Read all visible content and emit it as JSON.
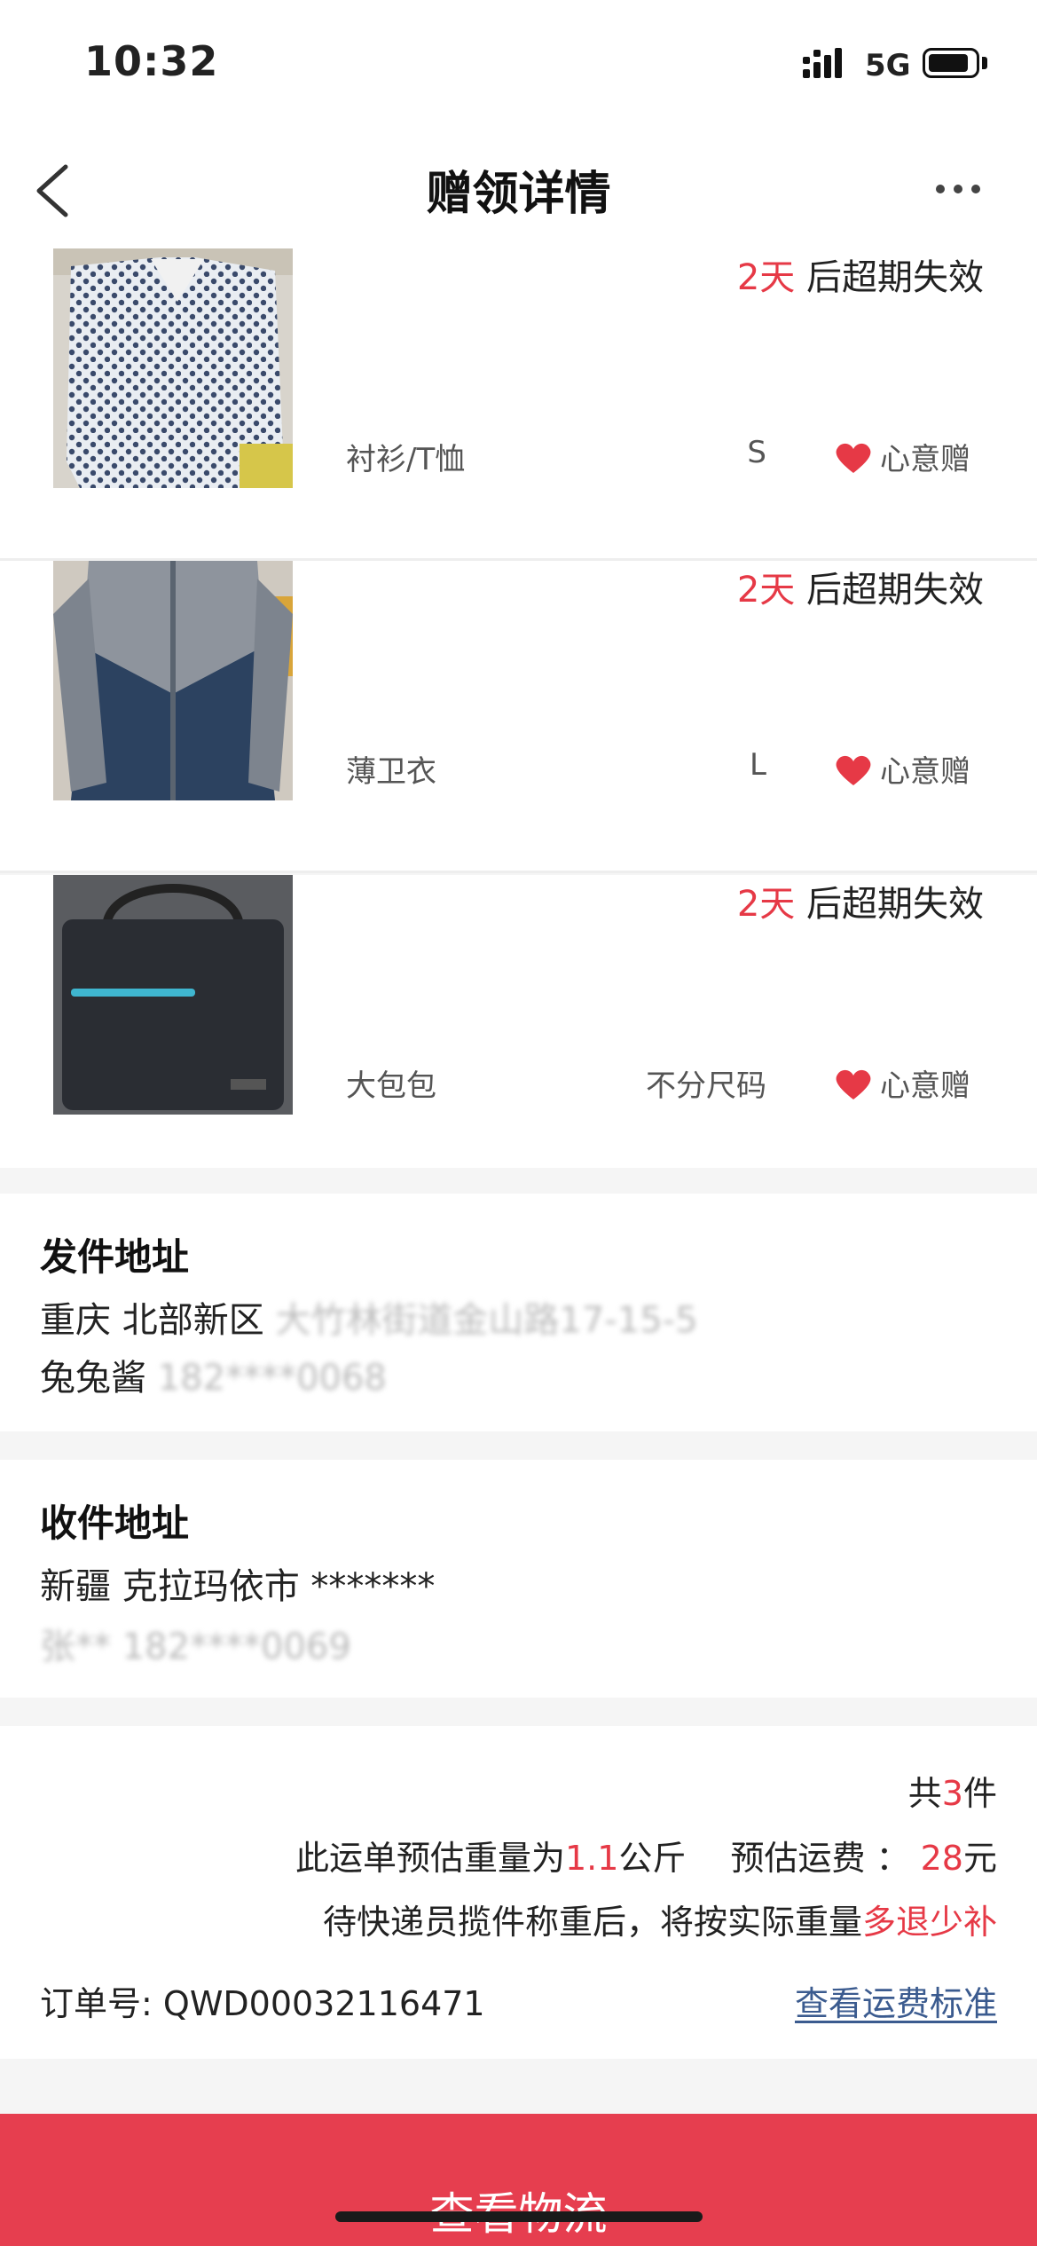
{
  "status_bar": {
    "time": "10:32",
    "network": "5G"
  },
  "nav": {
    "title": "赠领详情"
  },
  "items": [
    {
      "expire_days": "2天",
      "expire_suffix": " 后超期失效",
      "category": "衬衫/T恤",
      "size": "S",
      "gift_label": "心意赠",
      "image": "shirt-photo"
    },
    {
      "expire_days": "2天",
      "expire_suffix": " 后超期失效",
      "category": "薄卫衣",
      "size": "L",
      "gift_label": "心意赠",
      "image": "jacket-photo"
    },
    {
      "expire_days": "2天",
      "expire_suffix": " 后超期失效",
      "category": "大包包",
      "size": "不分尺码",
      "gift_label": "心意赠",
      "image": "bag-photo"
    }
  ],
  "sender": {
    "title": "发件地址",
    "address_visible": "重庆 北部新区",
    "address_blurred": "大竹林街道金山路17-15-5",
    "name_visible": "兔兔酱",
    "phone_blurred": "182****0068"
  },
  "receiver": {
    "title": "收件地址",
    "address": "新疆 克拉玛依市 *******",
    "contact_blurred": "张**  182****0069"
  },
  "summary": {
    "count_prefix": "共",
    "count": "3",
    "count_suffix": "件",
    "weight_prefix": "此运单预估重量为",
    "weight_value": "1.1",
    "weight_unit": "公斤",
    "fee_prefix": "预估运费 ：",
    "fee_value": "28",
    "fee_unit": "元",
    "note_prefix": "待快递员揽件称重后，将按实际重量",
    "note_highlight": "多退少补",
    "order_label": "订单号:",
    "order_number": "QWD00032116471",
    "fee_link": "查看运费标准"
  },
  "bottom_button": {
    "label": "查看物流"
  },
  "colors": {
    "accent_red": "#e63946",
    "button_red": "#e63e4f",
    "link_blue": "#3b5b8f"
  }
}
